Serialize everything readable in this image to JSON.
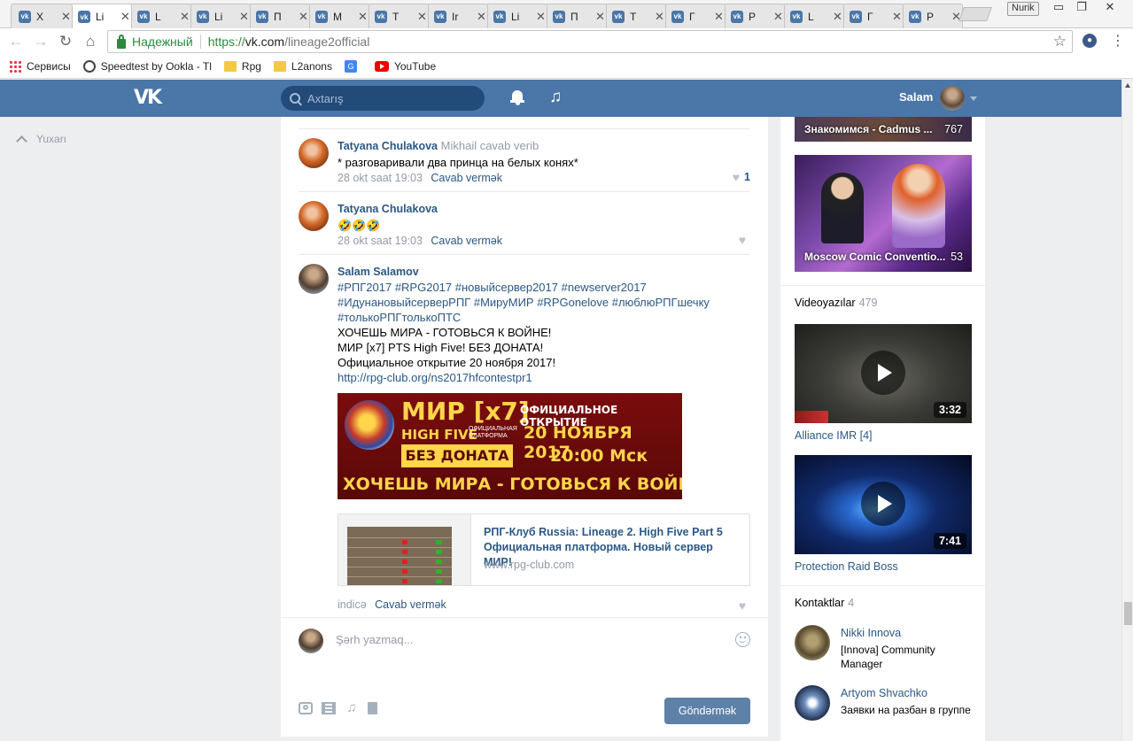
{
  "browser": {
    "tabs": [
      {
        "label": "X"
      },
      {
        "label": "Li"
      },
      {
        "label": "L"
      },
      {
        "label": "Li"
      },
      {
        "label": "П"
      },
      {
        "label": "M"
      },
      {
        "label": "T"
      },
      {
        "label": "Ir"
      },
      {
        "label": "Li"
      },
      {
        "label": "П"
      },
      {
        "label": "T"
      },
      {
        "label": "Г"
      },
      {
        "label": "P"
      },
      {
        "label": "L"
      },
      {
        "label": "Г"
      },
      {
        "label": "P"
      }
    ],
    "active_tab_index": 1,
    "profile_name": "Nurik",
    "secure_label": "Надежный",
    "url_proto": "https://",
    "url_host": "vk.com",
    "url_path": "/lineage2official",
    "bookmarks": [
      {
        "label": "Сервисы",
        "icon": "apps-icon"
      },
      {
        "label": "Speedtest by Ookla - Tl",
        "icon": "speedometer-icon"
      },
      {
        "label": "Rpg",
        "icon": "folder-icon"
      },
      {
        "label": "L2anons",
        "icon": "folder-icon"
      },
      {
        "label": "",
        "icon": "google-translate-icon"
      },
      {
        "label": "YouTube",
        "icon": "youtube-icon"
      }
    ]
  },
  "vk": {
    "logo": "VK",
    "search_placeholder": "Axtarış",
    "user_name": "Salam",
    "to_top": "Yuxarı"
  },
  "comments": [
    {
      "author": "Tatyana Chulakova",
      "reply_to": "Mikhail cavab verib",
      "text": "* разговаривали два принца на белых конях*",
      "date": "28 okt saat 19:03",
      "reply_label": "Cavab vermək",
      "likes": "1"
    },
    {
      "author": "Tatyana Chulakova",
      "reply_to": "",
      "text": "🤣🤣🤣",
      "date": "28 okt saat 19:03",
      "reply_label": "Cavab vermək",
      "likes": ""
    },
    {
      "author": "Salam Salamov",
      "reply_to": "",
      "hashtags_1": "#РПГ2017 #RPG2017 #новыйсервер2017 #newserver2017",
      "hashtags_2": "#ИдунановыйсерверРПГ #МируМИР #RPGonelove #любл​юРПГшечку",
      "hashtags_3": "#толькоРПГтолькоПТС",
      "line_1": "ХОЧЕШЬ МИРА - ГОТОВЬСЯ К ВОЙНЕ!",
      "line_2": "МИР [x7] PTS High Five! БЕЗ ДОНАТА!",
      "line_3": "Официальное открытие 20 ноября 2017!",
      "url": "http://rpg-club.org/ns2017hfcontestpr1",
      "banner": {
        "mir": "МИР [x7]",
        "high_five": "HIGH FIVE",
        "platform": "ОФИЦИАЛЬНАЯ ПЛАТФОРМА",
        "no_donate": "БЕЗ ДОНАТА",
        "opening": "ОФИЦИАЛЬНОЕ ОТКРЫТИЕ",
        "date": "20 НОЯБРЯ 2017",
        "time": "20:00 Мск",
        "war": "ХОЧЕШЬ МИРА - ГОТОВЬСЯ К ВОЙНЕ"
      },
      "link_title": "РПГ-Клуб Russia: Lineage 2. High Five Part 5 Официальная платформа. Новый сервер МИР!",
      "link_domain": "www.rpg-club.com",
      "date": "indicə",
      "reply_label": "Cavab vermək",
      "likes": ""
    }
  ],
  "reply_box": {
    "placeholder": "Şərh yazmaq...",
    "send_label": "Göndərmək"
  },
  "sidebar": {
    "album_top_caption": "Знакомимся - Cadmus ...",
    "album_top_count": "767",
    "album_caption": "Moscow Comic Conventio...",
    "album_count": "53",
    "videos_label": "Videoyazılar",
    "videos_count": "479",
    "videos": [
      {
        "title": "Alliance IMR [4]",
        "duration": "3:32"
      },
      {
        "title": "Protection Raid Boss",
        "duration": "7:41"
      }
    ],
    "contacts_label": "Kontaktlar",
    "contacts_count": "4",
    "contacts": [
      {
        "name": "Nikki Innova",
        "role": "[Innova] Community Manager"
      },
      {
        "name": "Artyom Shvachko",
        "role": "Заявки на разбан в группе"
      }
    ]
  },
  "colors": {
    "vk_header": "#4a76a8",
    "link": "#2a5885",
    "muted": "#939ba7",
    "page_bg": "#edeef0",
    "secure_green": "#2a8b3f"
  }
}
